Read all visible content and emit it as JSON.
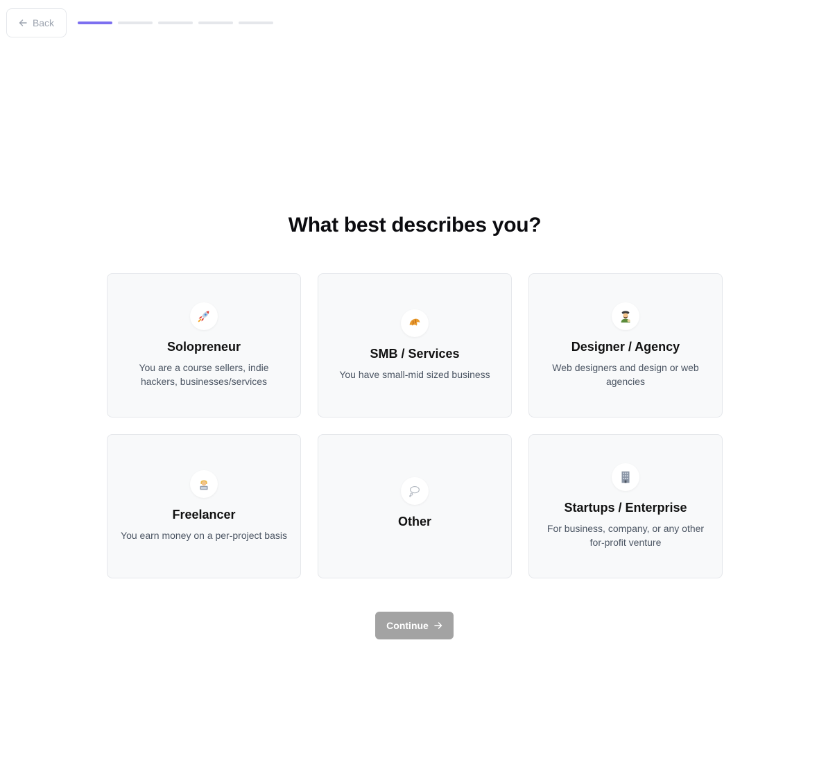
{
  "header": {
    "back_label": "Back",
    "progress": {
      "total_steps": 5,
      "current_step": 1
    }
  },
  "main": {
    "title": "What best describes you?",
    "options": [
      {
        "title": "Solopreneur",
        "description": "You are a course sellers, indie hackers, businesses/services",
        "icon": "rocket-icon"
      },
      {
        "title": "SMB / Services",
        "description": "You have small-mid sized business",
        "icon": "croissant-icon"
      },
      {
        "title": "Designer / Agency",
        "description": "Web designers and design or web agencies",
        "icon": "artist-icon"
      },
      {
        "title": "Freelancer",
        "description": "You earn money on a per-project basis",
        "icon": "technologist-icon"
      },
      {
        "title": "Other",
        "description": "",
        "icon": "thought-bubble-icon"
      },
      {
        "title": "Startups / Enterprise",
        "description": "For business, company, or any other for-profit venture",
        "icon": "office-building-icon"
      }
    ],
    "continue_label": "Continue"
  },
  "colors": {
    "accent": "#7c6ff0",
    "progress_inactive": "#e5e7eb",
    "card_bg": "#f8f9fa",
    "continue_disabled": "#a3a3a3"
  }
}
